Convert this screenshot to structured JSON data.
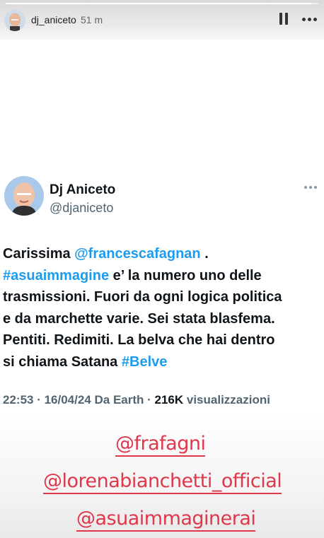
{
  "story": {
    "username": "dj_aniceto",
    "time_ago": "51 m",
    "progress": 0.98
  },
  "tweet": {
    "display_name": "Dj Aniceto",
    "handle": "@djaniceto",
    "lines": [
      [
        {
          "t": "Carissima ",
          "link": false
        },
        {
          "t": "@francescafagnan",
          "link": true
        },
        {
          "t": " .",
          "link": false
        }
      ],
      [
        {
          "t": "#asuaimmagine",
          "link": true
        },
        {
          "t": "  e’ la numero uno delle",
          "link": false
        }
      ],
      [
        {
          "t": "trasmissioni. Fuori da ogni logica politica",
          "link": false
        }
      ],
      [
        {
          "t": "e da marchette varie. Sei stata blasfema.",
          "link": false
        }
      ],
      [
        {
          "t": "Pentiti. Redimiti. La belva che hai dentro",
          "link": false
        }
      ],
      [
        {
          "t": "si chiama Satana ",
          "link": false
        },
        {
          "t": "#Belve",
          "link": true
        }
      ]
    ],
    "meta": {
      "datetime": "22:53 · 16/04/24 Da Earth · ",
      "views_count": "216K",
      "views_label": " visualizzazioni"
    }
  },
  "mentions": [
    "@frafagni",
    "@lorenabianchetti_official",
    "@asuaimmaginerai"
  ],
  "colors": {
    "link": "#1d9bf0",
    "mention_tag": "#e0374a",
    "text": "#0f1419",
    "secondary": "#536471"
  }
}
